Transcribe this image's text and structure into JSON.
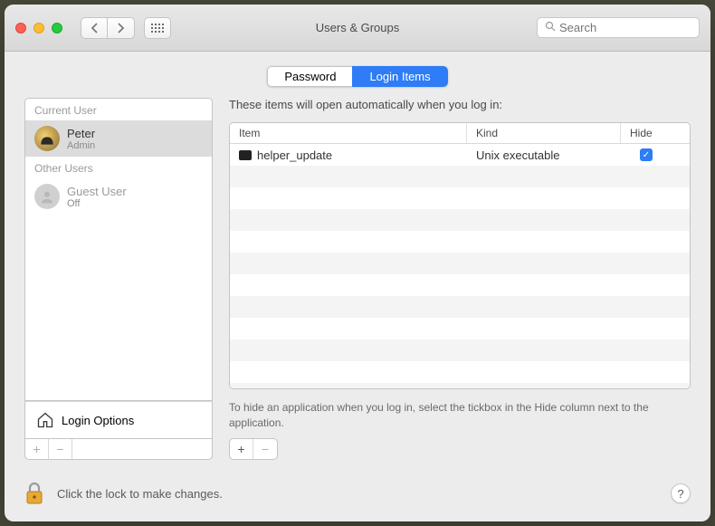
{
  "window": {
    "title": "Users & Groups",
    "search_placeholder": "Search"
  },
  "tabs": {
    "password": "Password",
    "login_items": "Login Items",
    "active": "login_items"
  },
  "sidebar": {
    "sections": {
      "current": "Current User",
      "other": "Other Users"
    },
    "current_user": {
      "name": "Peter",
      "role": "Admin"
    },
    "other_users": [
      {
        "name": "Guest User",
        "role": "Off"
      }
    ],
    "login_options": "Login Options"
  },
  "main": {
    "description": "These items will open automatically when you log in:",
    "columns": {
      "item": "Item",
      "kind": "Kind",
      "hide": "Hide"
    },
    "rows": [
      {
        "item": "helper_update",
        "kind": "Unix executable",
        "hide": true
      }
    ],
    "hint": "To hide an application when you log in, select the tickbox in the Hide column next to the application."
  },
  "footer": {
    "lock_text": "Click the lock to make changes.",
    "help": "?"
  }
}
